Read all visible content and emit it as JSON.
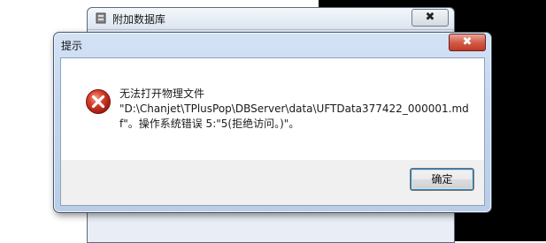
{
  "background_window": {
    "title": "附加数据库",
    "close_label": "✖"
  },
  "dialog": {
    "title": "提示",
    "close_label": "✖",
    "icon": "error-icon",
    "message_lines": [
      "无法打开物理文件",
      "\"D:\\Chanjet\\TPlusPop\\DBServer\\data\\UFTData377422_000001.md",
      "f\"。操作系统错误 5:\"5(拒绝访问。)\"。"
    ],
    "ok_label": "确定"
  },
  "colors": {
    "error_red": "#c4281c",
    "close_red": "#c13b26"
  }
}
